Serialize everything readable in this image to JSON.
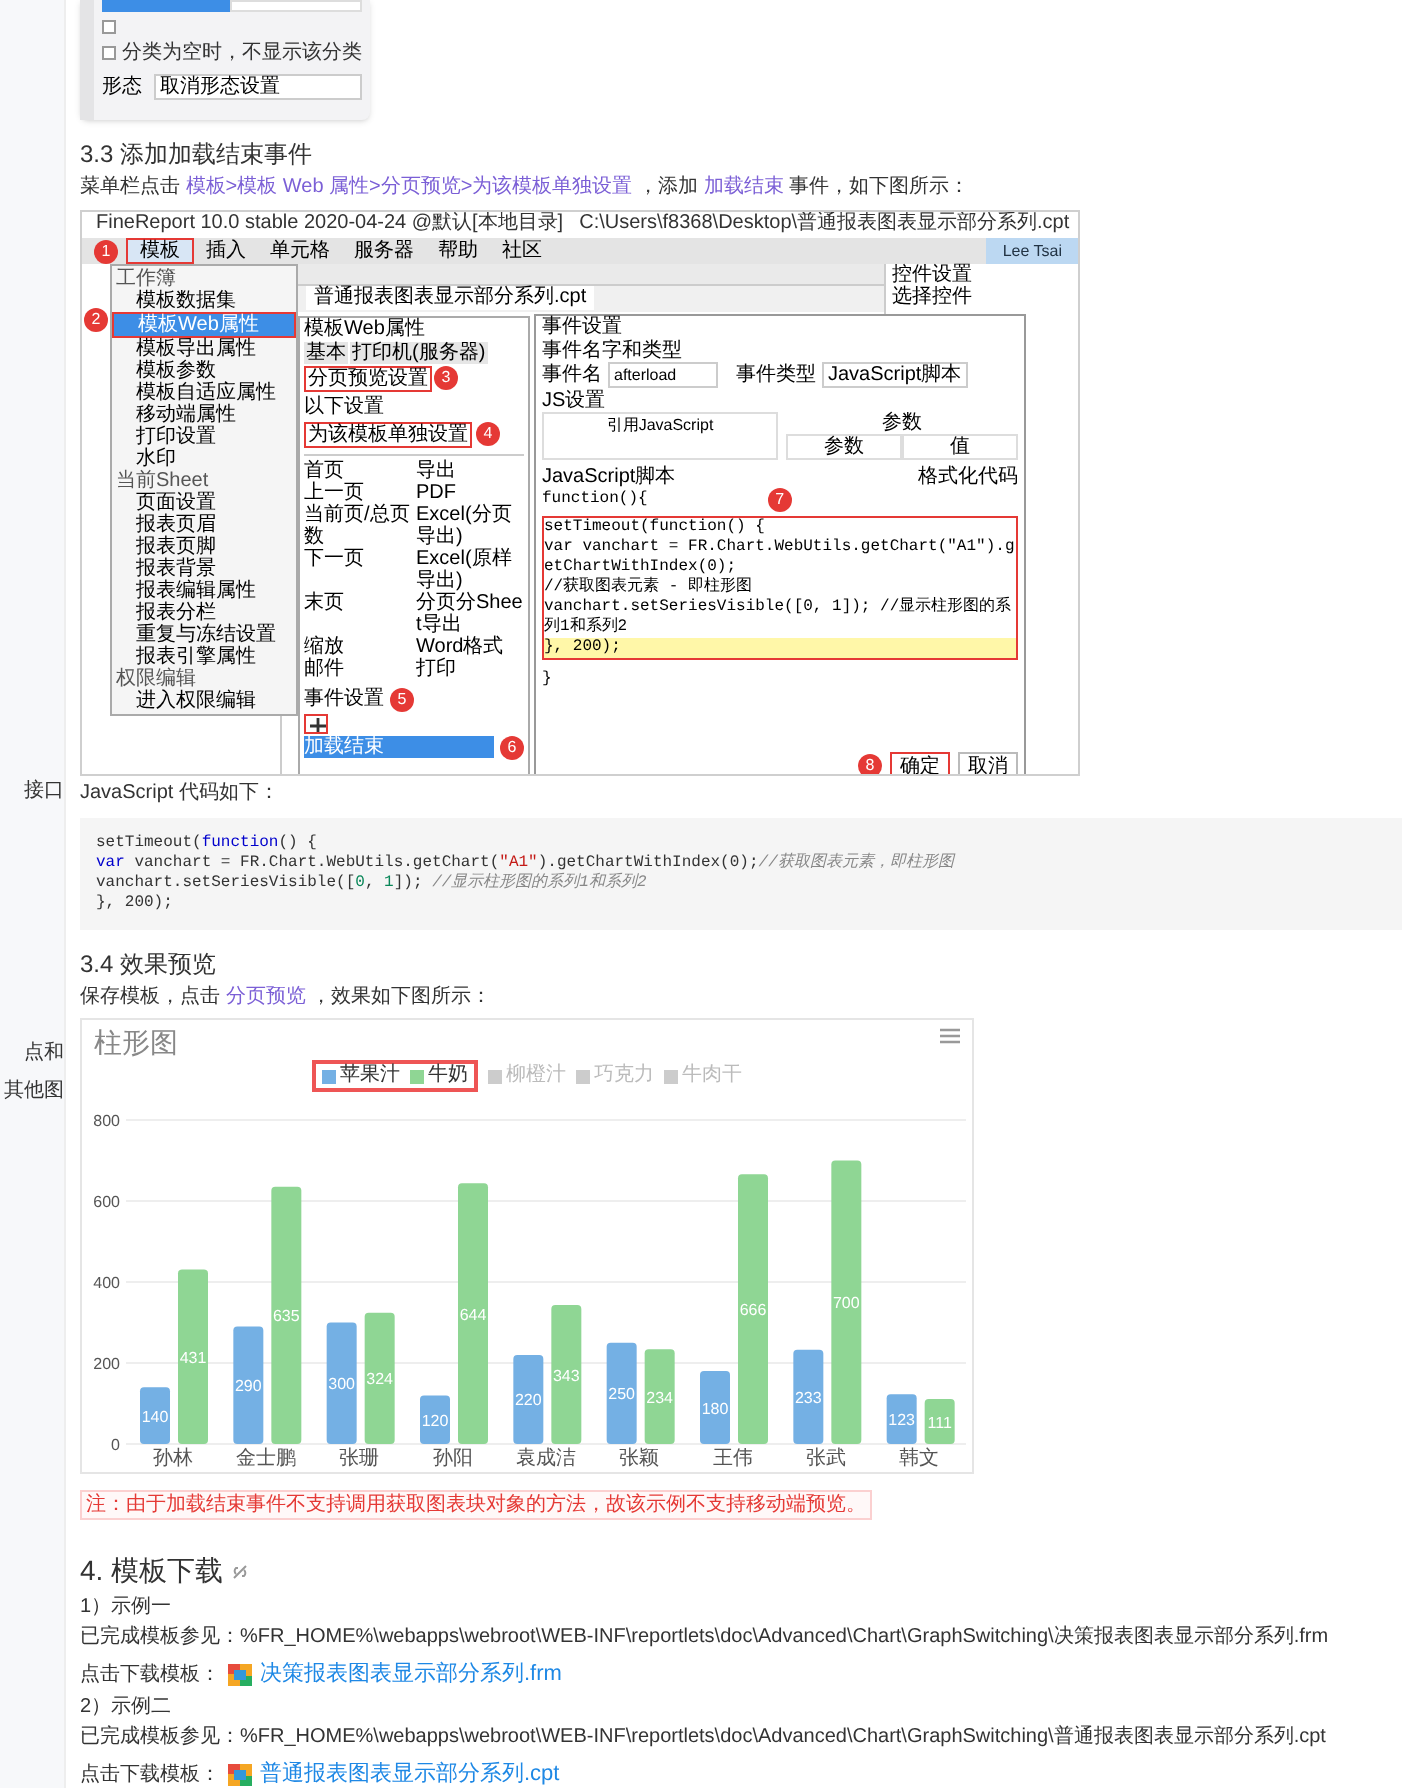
{
  "sidebar": {
    "fragments": [
      "接口",
      "点和",
      "其他图"
    ]
  },
  "top_panel": {
    "tabs": [
      {
        "selected": true
      },
      {
        "selected": false
      }
    ],
    "checkboxes": [
      {
        "checked": false
      },
      {
        "label": "分类为空时，不显示该分类",
        "checked": false
      }
    ],
    "field_label": "形态",
    "field_value": "取消形态设置"
  },
  "section_33": {
    "heading": "3.3 添加加载结束事件",
    "intro": [
      {
        "kind": "text",
        "text": "菜单栏点击 "
      },
      {
        "kind": "link",
        "text": "模板>模板 Web 属性>分页预览>为该模板单独设置"
      },
      {
        "kind": "text",
        "text": " ，添加 "
      },
      {
        "kind": "link",
        "text": "加载结束"
      },
      {
        "kind": "text",
        "text": " 事件，如下图所示："
      }
    ]
  },
  "screenshot": {
    "title": "FineReport 10.0 stable 2020-04-24 @默认[本地目录]",
    "file_path": "C:\\Users\\f8368\\Desktop\\普通报表图表显示部分系列.cpt",
    "menu": [
      {
        "label": "模板",
        "selected": true
      },
      {
        "label": "插入",
        "selected": false
      },
      {
        "label": "单元格",
        "selected": false
      },
      {
        "label": "服务器",
        "selected": false
      },
      {
        "label": "帮助",
        "selected": false
      },
      {
        "label": "社区",
        "selected": false
      }
    ],
    "user": "Lee Tsai",
    "file_tab": "普通报表图表显示部分系列.cpt",
    "dropdown": [
      {
        "kind": "header",
        "label": "工作簿"
      },
      {
        "kind": "item",
        "label": "模板数据集",
        "selected": false
      },
      {
        "kind": "item",
        "label": "模板Web属性",
        "selected": true
      },
      {
        "kind": "item",
        "label": "模板导出属性",
        "selected": false
      },
      {
        "kind": "item",
        "label": "模板参数",
        "selected": false
      },
      {
        "kind": "item",
        "label": "模板自适应属性",
        "selected": false
      },
      {
        "kind": "item",
        "label": "移动端属性",
        "selected": false
      },
      {
        "kind": "item",
        "label": "打印设置",
        "selected": false
      },
      {
        "kind": "item",
        "label": "水印",
        "selected": false
      },
      {
        "kind": "header",
        "label": "当前Sheet"
      },
      {
        "kind": "item",
        "label": "页面设置",
        "selected": false
      },
      {
        "kind": "item",
        "label": "报表页眉",
        "selected": false
      },
      {
        "kind": "item",
        "label": "报表页脚",
        "selected": false
      },
      {
        "kind": "item",
        "label": "报表背景",
        "selected": false
      },
      {
        "kind": "item",
        "label": "报表编辑属性",
        "selected": false
      },
      {
        "kind": "item",
        "label": "报表分栏",
        "selected": false
      },
      {
        "kind": "item",
        "label": "重复与冻结设置",
        "selected": false
      },
      {
        "kind": "item",
        "label": "报表引擎属性",
        "selected": false
      },
      {
        "kind": "header",
        "label": "权限编辑"
      },
      {
        "kind": "item",
        "label": "进入权限编辑",
        "selected": false
      }
    ],
    "web_attr": {
      "title": "模板Web属性",
      "tabs": [
        {
          "label": "基本",
          "selected": false
        },
        {
          "label": "打印机(服务器)",
          "selected": false
        },
        {
          "label": "分页预览设置",
          "selected": true
        }
      ],
      "setting_label": "以下设置",
      "setting_value": "为该模板单独设置",
      "toolbar_items": [
        "首页",
        "导出",
        "上一页",
        "PDF",
        "当前页/总页数",
        "Excel(分页导出)",
        "下一页",
        "Excel(原样导出)",
        "末页",
        "分页分Sheet导出",
        "缩放",
        "Word格式",
        "邮件",
        "打印"
      ],
      "event_label": "事件设置",
      "events": [
        {
          "label": "加载结束",
          "selected": true
        }
      ]
    },
    "event_dialog": {
      "title": "事件设置",
      "section": "事件名字和类型",
      "name_label": "事件名",
      "name_value": "afterload",
      "type_label": "事件类型",
      "type_value": "JavaScript脚本",
      "js_section": "JS设置",
      "ref_column": "引用JavaScript",
      "params_label": "参数",
      "param_columns": [
        "参数",
        "值"
      ],
      "script_label": "JavaScript脚本",
      "format_button": "格式化代码",
      "function_header": "function(){",
      "code": [
        "setTimeout(function() {",
        "var vanchart = FR.Chart.WebUtils.getChart(\"A1\").getChartWithIndex(0);",
        "//获取图表元素 - 即柱形图",
        "vanchart.setSeriesVisible([0, 1]); //显示柱形图的系列1和系列2",
        "}, 200);"
      ],
      "closing": "}",
      "buttons": [
        {
          "label": "确定",
          "primary": true
        },
        {
          "label": "取消",
          "primary": false
        }
      ]
    },
    "right_panel": {
      "title": "控件设置",
      "field_label": "选择控件"
    },
    "badges": [
      "1",
      "2",
      "3",
      "4",
      "5",
      "6",
      "7",
      "8"
    ]
  },
  "code_intro": "JavaScript 代码如下：",
  "code_block": [
    [
      {
        "kind": "plain",
        "text": "setTimeout("
      },
      {
        "kind": "keyword",
        "text": "function"
      },
      {
        "kind": "plain",
        "text": "() {"
      }
    ],
    [
      {
        "kind": "keyword",
        "text": "var"
      },
      {
        "kind": "plain",
        "text": " vanchart = FR.Chart.WebUtils.getChart("
      },
      {
        "kind": "string",
        "text": "\"A1\""
      },
      {
        "kind": "plain",
        "text": ").getChartWithIndex(0);"
      },
      {
        "kind": "comment",
        "text": "//获取图表元素，即柱形图"
      }
    ],
    [
      {
        "kind": "plain",
        "text": "vanchart.setSeriesVisible(["
      },
      {
        "kind": "number",
        "text": "0"
      },
      {
        "kind": "plain",
        "text": ", "
      },
      {
        "kind": "number",
        "text": "1"
      },
      {
        "kind": "plain",
        "text": "]); "
      },
      {
        "kind": "comment",
        "text": "//显示柱形图的系列1和系列2"
      }
    ],
    [
      {
        "kind": "plain",
        "text": "}, 200);"
      }
    ]
  ],
  "section_34": {
    "heading": "3.4 效果预览",
    "intro": [
      {
        "kind": "text",
        "text": "保存模板，点击 "
      },
      {
        "kind": "link",
        "text": "分页预览"
      },
      {
        "kind": "text",
        "text": " ，效果如下图所示："
      }
    ],
    "chart_data": {
      "type": "bar",
      "title": "柱形图",
      "categories": [
        "孙林",
        "金士鹏",
        "张珊",
        "孙阳",
        "袁成洁",
        "张颖",
        "王伟",
        "张武",
        "韩文"
      ],
      "series": [
        {
          "name": "苹果汁",
          "color": "#74b0e4",
          "values": [
            140,
            290,
            300,
            120,
            220,
            250,
            180,
            233,
            123
          ]
        },
        {
          "name": "牛奶",
          "color": "#8fd694",
          "values": [
            431,
            635,
            324,
            644,
            343,
            234,
            666,
            700,
            111
          ]
        }
      ],
      "legend": {
        "items": [
          {
            "label": "柳橙汁",
            "active": false
          },
          {
            "label": "巧克力",
            "active": false
          },
          {
            "label": "牛肉干",
            "active": false
          }
        ]
      },
      "grid": true,
      "ylim": [
        0,
        800
      ],
      "yticks": [
        0,
        200,
        400,
        600,
        800
      ],
      "data_labels": true
    },
    "note": "注：由于加载结束事件不支持调用获取图表块对象的方法，故该示例不支持移动端预览。"
  },
  "section_4": {
    "heading": "4. 模板下载",
    "examples": [
      {
        "label": "1）示例一",
        "path": "已完成模板参见：%FR_HOME%\\webapps\\webroot\\WEB-INF\\reportlets\\doc\\Advanced\\Chart\\GraphSwitching\\决策报表图表显示部分系列.frm",
        "download_label": "点击下载模板：",
        "file": "决策报表图表显示部分系列.frm"
      },
      {
        "label": "2）示例二",
        "path": "已完成模板参见：%FR_HOME%\\webapps\\webroot\\WEB-INF\\reportlets\\doc\\Advanced\\Chart\\GraphSwitching\\普通报表图表显示部分系列.cpt",
        "download_label": "点击下载模板：",
        "file": "普通报表图表显示部分系列.cpt"
      }
    ]
  }
}
